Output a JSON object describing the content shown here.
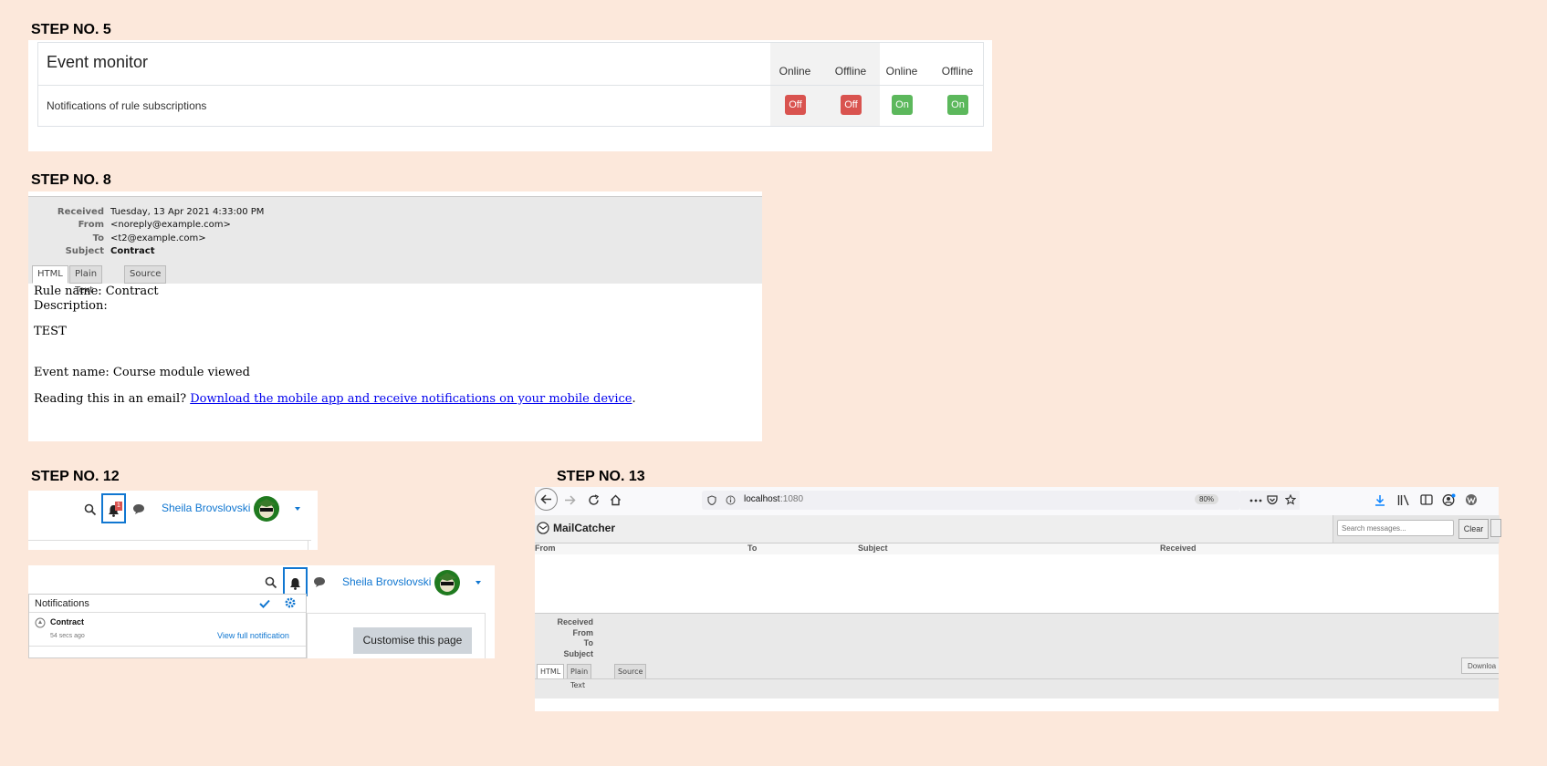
{
  "steps": {
    "s5": "STEP NO. 5",
    "s8": "STEP NO. 8",
    "s12": "STEP NO. 12",
    "s13": "STEP NO. 13"
  },
  "event_monitor": {
    "title": "Event monitor",
    "row_label": "Notifications of rule subscriptions",
    "columns": [
      "Online",
      "Offline",
      "Online",
      "Offline"
    ],
    "toggles": [
      "Off",
      "Off",
      "On",
      "On"
    ]
  },
  "email": {
    "received_label": "Received",
    "received": "Tuesday, 13 Apr 2021 4:33:00 PM",
    "from_label": "From",
    "from": "<noreply@example.com>",
    "to_label": "To",
    "to": "<t2@example.com>",
    "subject_label": "Subject",
    "subject": "Contract",
    "tabs": [
      "HTML",
      "Plain Text",
      "Source"
    ],
    "body": {
      "line1": "Rule name: Contract",
      "line2": "Description:",
      "line3": "TEST",
      "line4": "Event name: Course module viewed",
      "line5_prefix": "Reading this in an email? ",
      "line5_link": "Download the mobile app and receive notifications on your mobile device",
      "line5_suffix": "."
    }
  },
  "navbar": {
    "username": "Sheila Brovslovski",
    "badge_count": "1",
    "notifications_title": "Notifications",
    "notification_item": "Contract",
    "notification_time": "54 secs ago",
    "view_full": "View full notification",
    "customise": "Customise this page"
  },
  "mailcatcher": {
    "url_host": "localhost",
    "url_port": ":1080",
    "zoom": "80%",
    "app_title": "MailCatcher",
    "search_placeholder": "Search messages...",
    "clear_label": "Clear",
    "columns": [
      "From",
      "To",
      "Subject",
      "Received"
    ],
    "meta_labels": [
      "Received",
      "From",
      "To",
      "Subject"
    ],
    "tabs": [
      "HTML",
      "Plain Text",
      "Source"
    ],
    "download_label": "Downloa"
  },
  "colors": {
    "background": "#fce8db",
    "off": "#d9534f",
    "on": "#5cb85c",
    "link": "#1177d1"
  }
}
